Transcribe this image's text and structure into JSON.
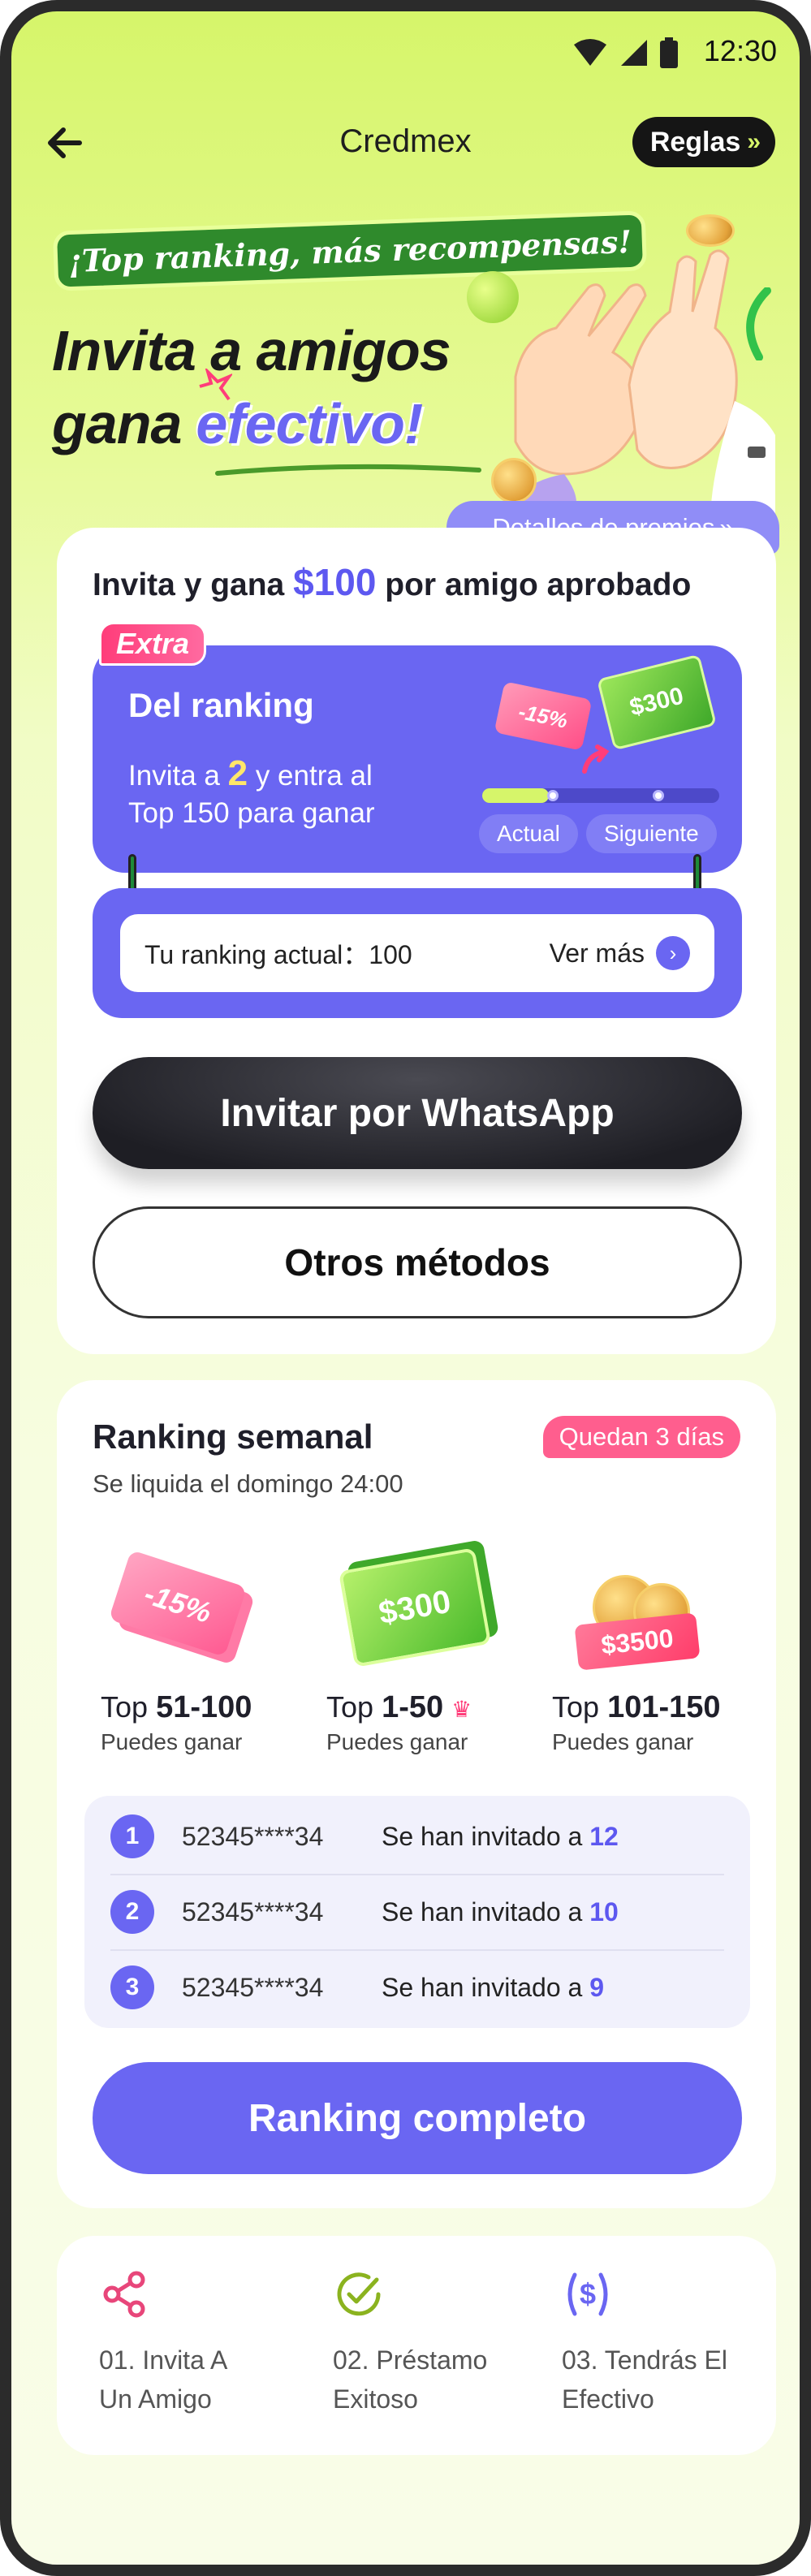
{
  "status_bar": {
    "time": "12:30"
  },
  "header": {
    "title": "Credmex",
    "rules_label": "Reglas"
  },
  "hero": {
    "tagline": "¡Top ranking, más recompensas!",
    "title_line1": "Invita a amigos",
    "title_line2_a": "gana",
    "title_line2_b": "efectivo",
    "title_line2_c": "!"
  },
  "prize_details_label": "Detalles de premios",
  "invite_card": {
    "gain_prefix": "Invita y gana",
    "gain_amount": "$100",
    "gain_suffix": "por amigo aprobado",
    "extra_tag": "Extra",
    "extra_title": "Del ranking",
    "extra_desc_a": "Invita a",
    "extra_desc_num": "2",
    "extra_desc_b": "y entra al",
    "extra_desc_c": "Top 150 para ganar",
    "coupon_label": "-15%",
    "cash_label": "$300",
    "progress_current_label": "Actual",
    "progress_next_label": "Siguiente",
    "progress_fraction": 0.28,
    "current_ranking_label": "Tu ranking actual：100",
    "see_more_label": "Ver más",
    "whatsapp_button": "Invitar por WhatsApp",
    "other_methods_button": "Otros métodos"
  },
  "weekly": {
    "title": "Ranking semanal",
    "days_left": "Quedan 3 días",
    "settle_text": "Se liquida el domingo 24:00",
    "tiers": [
      {
        "prefix": "Top",
        "range": "51-100",
        "can_win": "Puedes ganar",
        "prize": "-15%"
      },
      {
        "prefix": "Top",
        "range": "1-50",
        "can_win": "Puedes ganar",
        "prize": "$300"
      },
      {
        "prefix": "Top",
        "range": "101-150",
        "can_win": "Puedes ganar",
        "prize": "$3500"
      }
    ],
    "leaders": [
      {
        "rank": "1",
        "phone": "52345****34",
        "invited_label": "Se han invitado a",
        "count": "12"
      },
      {
        "rank": "2",
        "phone": "52345****34",
        "invited_label": "Se han invitado a",
        "count": "10"
      },
      {
        "rank": "3",
        "phone": "52345****34",
        "invited_label": "Se han invitado a",
        "count": "9"
      }
    ],
    "full_ranking_button": "Ranking completo"
  },
  "steps": [
    {
      "icon": "share-icon",
      "line1": "01. Invita A",
      "line2": "Un Amigo",
      "color": "#e8467a"
    },
    {
      "icon": "check-circle-icon",
      "line1": "02. Préstamo",
      "line2": "Exitoso",
      "color": "#8bb31f"
    },
    {
      "icon": "dollar-circle-icon",
      "line1": "03. Tendrás El",
      "line2": "Efectivo",
      "color": "#6a66f2"
    }
  ],
  "colors": {
    "accent": "#6a66f2",
    "lime": "#d6f56a",
    "pink": "#ff5e8e",
    "dark": "#1e1e24"
  }
}
